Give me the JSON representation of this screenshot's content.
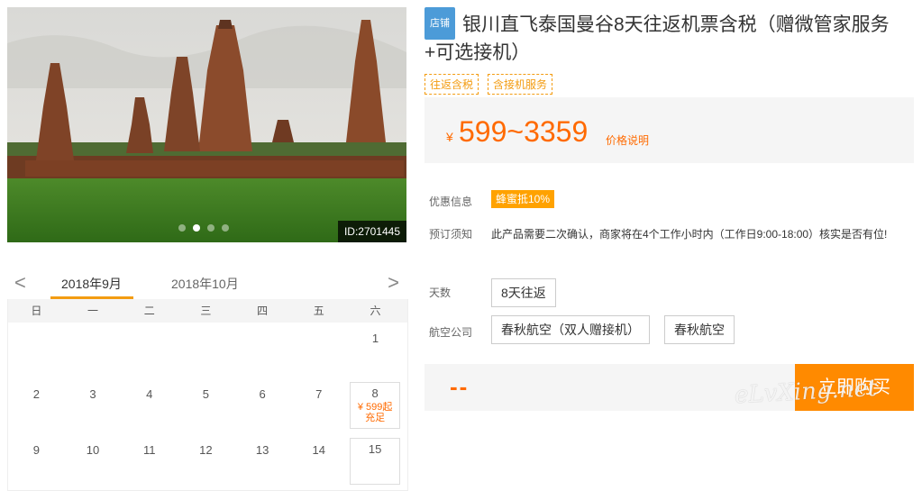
{
  "gallery": {
    "image_id": "ID:2701445",
    "dot_count": 4,
    "active_dot": 1
  },
  "calendar": {
    "prev_arrow": "<",
    "next_arrow": ">",
    "months": [
      "2018年9月",
      "2018年10月"
    ],
    "weekdays": [
      "日",
      "一",
      "二",
      "三",
      "四",
      "五",
      "六"
    ],
    "rows": [
      [
        "",
        "",
        "",
        "",
        "",
        "",
        "1"
      ],
      [
        "2",
        "3",
        "4",
        "5",
        "6",
        "7",
        "8"
      ],
      [
        "9",
        "10",
        "11",
        "12",
        "13",
        "14",
        "15"
      ]
    ],
    "day8": {
      "price": "¥ 599起",
      "status": "充足"
    }
  },
  "product": {
    "shop_badge": "店铺",
    "title": "银川直飞泰国曼谷8天往返机票含税（赠微管家服务+可选接机）",
    "tags": [
      "往返含税",
      "含接机服务"
    ],
    "price_currency": "¥",
    "price_range": "599~3359",
    "price_note": "价格说明"
  },
  "info": {
    "promo_label": "优惠信息",
    "promo_badge": "蜂蜜抵10%",
    "booking_label": "预订须知",
    "booking_text": "此产品需要二次确认，商家将在4个工作小时内（工作日9:00-18:00）核实是否有位!",
    "days_label": "天数",
    "days_option": "8天往返",
    "airline_label": "航空公司",
    "airline_options": [
      "春秋航空（双人赠接机）",
      "春秋航空"
    ]
  },
  "buy": {
    "total": "--",
    "button": "立即购买"
  },
  "watermark": "eLvXing.net"
}
